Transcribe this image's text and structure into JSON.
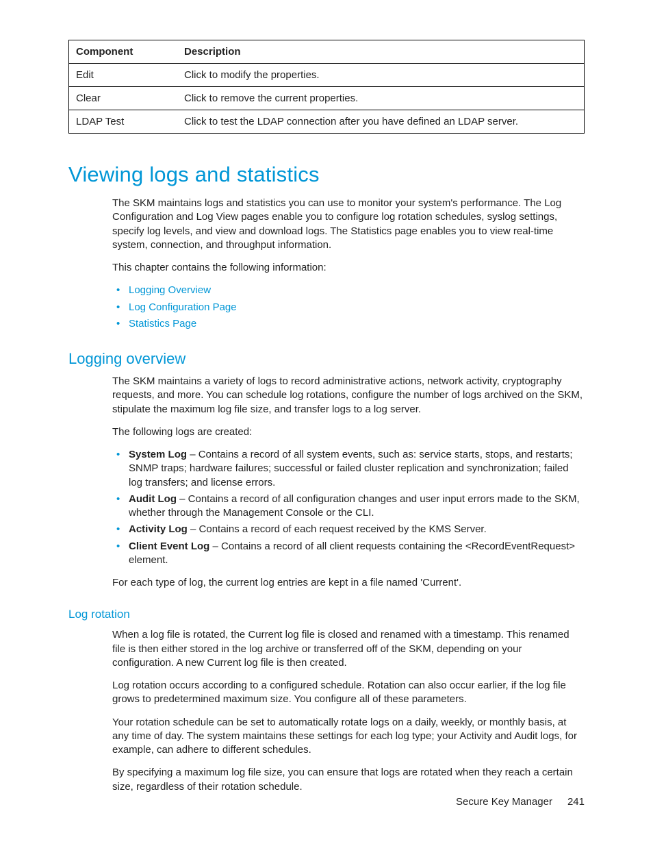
{
  "table": {
    "headers": {
      "component": "Component",
      "description": "Description"
    },
    "rows": [
      {
        "component": "Edit",
        "description": "Click to modify the properties."
      },
      {
        "component": "Clear",
        "description": "Click to remove the current properties."
      },
      {
        "component": "LDAP Test",
        "description": "Click to test the LDAP connection after you have defined an LDAP server."
      }
    ]
  },
  "h1": "Viewing logs and statistics",
  "intro_para": "The SKM maintains logs and statistics you can use to monitor your system's performance. The Log Configuration and Log View pages enable you to configure log rotation schedules, syslog settings, specify log levels, and view and download logs. The Statistics page enables you to view real-time system, connection, and throughput information.",
  "chapter_line": "This chapter contains the following information:",
  "chapter_links": [
    "Logging Overview",
    "Log Configuration Page",
    "Statistics Page"
  ],
  "logging_overview": {
    "title": "Logging overview",
    "para1": "The SKM maintains a variety of logs to record administrative actions, network activity, cryptography requests, and more. You can schedule log rotations, configure the number of logs archived on the SKM, stipulate the maximum log file size, and transfer logs to a log server.",
    "para2": "The following logs are created:",
    "logs": [
      {
        "name": "System Log",
        "desc": " – Contains a record of all system events, such as: service starts, stops, and restarts; SNMP traps; hardware failures; successful or failed cluster replication and synchronization; failed log transfers; and license errors."
      },
      {
        "name": "Audit Log",
        "desc": " – Contains a record of all configuration changes and user input errors made to the SKM, whether through the Management Console or the CLI."
      },
      {
        "name": "Activity Log",
        "desc": " – Contains a record of each request received by the KMS Server."
      },
      {
        "name": "Client Event Log",
        "desc": " – Contains a record of all client requests containing the <RecordEventRequest> element."
      }
    ],
    "para3": "For each type of log, the current log entries are kept in a file named 'Current'."
  },
  "log_rotation": {
    "title": "Log rotation",
    "para1": "When a log file is rotated, the Current log file is closed and renamed with a timestamp. This renamed file is then either stored in the log archive or transferred off of the SKM, depending on your configuration. A new Current log file is then created.",
    "para2": "Log rotation occurs according to a configured schedule. Rotation can also occur earlier, if the log file grows to predetermined maximum size. You configure all of these parameters.",
    "para3": "Your rotation schedule can be set to automatically rotate logs on a daily, weekly, or monthly basis, at any time of day. The system maintains these settings for each log type; your Activity and Audit logs, for example, can adhere to different schedules.",
    "para4": "By specifying a maximum log file size, you can ensure that logs are rotated when they reach a certain size, regardless of their rotation schedule."
  },
  "footer": {
    "title": "Secure Key Manager",
    "page": "241"
  }
}
